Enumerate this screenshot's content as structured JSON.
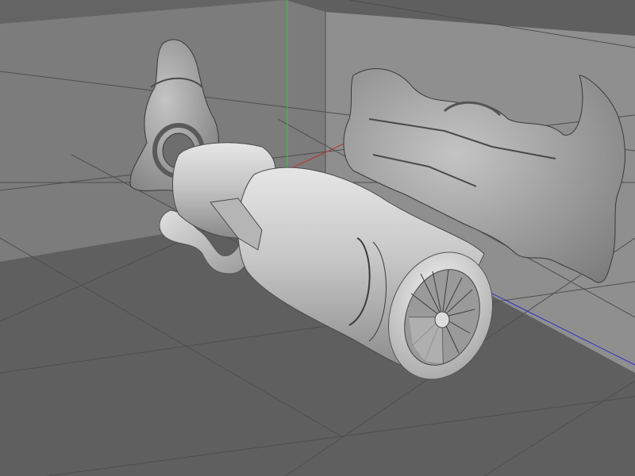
{
  "viewport": {
    "background_color": "#666666",
    "floor_color": "#5e5e5e",
    "wall_color": "#8e8e8e",
    "grid_line_color": "#4e4e4e",
    "axis_colors": {
      "x": "#cc2222",
      "y": "#22cc22",
      "z": "#2222cc"
    }
  },
  "scene": {
    "objects": [
      {
        "name": "jet-engine-model",
        "surface_color": "#c7c7c7"
      },
      {
        "name": "side-view-reference-image",
        "surface_color": "#a8a8a8"
      },
      {
        "name": "front-view-reference-image",
        "surface_color": "#a0a0a0"
      }
    ]
  }
}
